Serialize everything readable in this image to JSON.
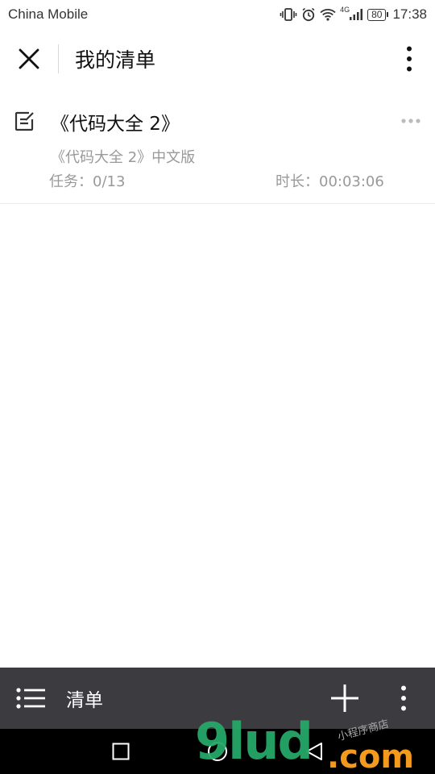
{
  "status_bar": {
    "carrier": "China Mobile",
    "network": "4G",
    "battery": "80",
    "time": "17:38",
    "icons": [
      "vibrate-icon",
      "alarm-icon",
      "wifi-icon",
      "signal-icon",
      "battery-icon"
    ]
  },
  "header": {
    "title": "我的清单",
    "close_icon": "close-icon",
    "more_icon": "more-vertical-icon"
  },
  "list": {
    "items": [
      {
        "title": "《代码大全 2》",
        "description": "《代码大全 2》中文版",
        "tasks": "任务：0/13",
        "duration": "时长：00:03:06",
        "icon": "edit-note-icon",
        "more_icon": "more-horizontal-icon"
      }
    ]
  },
  "toolbar": {
    "label": "清单",
    "menu_icon": "list-icon",
    "add_icon": "plus-icon",
    "more_icon": "more-vertical-icon"
  },
  "nav_bar": {
    "icons": [
      "recent-apps-icon",
      "home-icon",
      "back-icon"
    ]
  },
  "watermark": {
    "logo": "9lud",
    "suffix": ".com",
    "tagline": "小程序商店"
  },
  "colors": {
    "toolbar_bg": "#3c3c40",
    "secondary_text": "#999999",
    "watermark_green": "#25a86a",
    "watermark_orange": "#f39a1e"
  }
}
